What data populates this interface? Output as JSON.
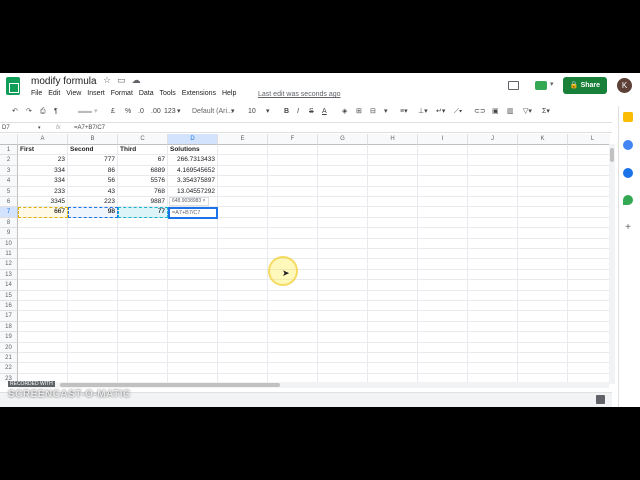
{
  "title": {
    "doc_name": "modify formula",
    "last_edit": "Last edit was seconds ago",
    "share_label": "Share",
    "avatar_letter": "K"
  },
  "menu": [
    "File",
    "Edit",
    "View",
    "Insert",
    "Format",
    "Data",
    "Tools",
    "Extensions",
    "Help"
  ],
  "toolbar": {
    "currency": "£",
    "percent": "%",
    "dec_minus": ".0",
    "dec_plus": ".00",
    "more_formats": "123",
    "font": "Default (Ari...",
    "font_size": "10",
    "bold": "B",
    "italic": "I",
    "strike": "S",
    "text_color": "A"
  },
  "formula_bar": {
    "name_box": "D7",
    "fx": "fx",
    "formula": "=A7+B7/C7"
  },
  "grid": {
    "columns": [
      "A",
      "B",
      "C",
      "D",
      "E",
      "F",
      "G",
      "H",
      "I",
      "J",
      "K",
      "L"
    ],
    "rows": [
      "1",
      "2",
      "3",
      "4",
      "5",
      "6",
      "7",
      "8",
      "9",
      "10",
      "11",
      "12",
      "13",
      "14",
      "15",
      "16",
      "17",
      "18",
      "19",
      "20",
      "21",
      "22",
      "23"
    ],
    "headers": [
      "First",
      "Second",
      "Third",
      "Solutions"
    ],
    "data": [
      [
        "23",
        "777",
        "67",
        "266.7313433"
      ],
      [
        "334",
        "86",
        "6889",
        "4.169545652"
      ],
      [
        "334",
        "56",
        "5576",
        "3.354375897"
      ],
      [
        "233",
        "43",
        "768",
        "13.04557292"
      ],
      [
        "3345",
        "223",
        "9887",
        ""
      ],
      [
        "667",
        "98",
        "77",
        ""
      ]
    ],
    "active_cell_text": "=A7+B7/C7",
    "tooltip_text": "648.9038983 ×"
  },
  "watermark": {
    "recorded": "RECORDED WITH",
    "brand": "SCREENCAST-O-MATIC"
  },
  "colors": {
    "share": "#188038",
    "selection": "#1a73e8",
    "sheets_green": "#0f9d58"
  }
}
